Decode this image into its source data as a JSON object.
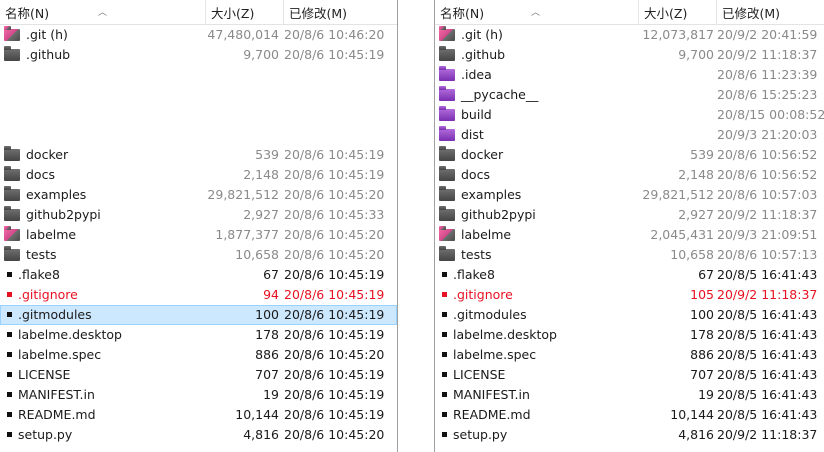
{
  "left": {
    "columns": {
      "name": "名称(N)",
      "size": "大小(Z)",
      "modified": "已修改(M)"
    },
    "rows": [
      {
        "name": ".git (h)",
        "icon": "folder-pink-icon",
        "size": "47,480,014",
        "date": "20/8/6 10:46:20"
      },
      {
        "name": ".github",
        "icon": "folder-gray-icon",
        "size": "9,700",
        "date": "20/8/6 10:45:19"
      },
      {
        "name": "",
        "icon": "",
        "size": "",
        "date": ""
      },
      {
        "name": "",
        "icon": "",
        "size": "",
        "date": ""
      },
      {
        "name": "",
        "icon": "",
        "size": "",
        "date": ""
      },
      {
        "name": "",
        "icon": "",
        "size": "",
        "date": ""
      },
      {
        "name": "docker",
        "icon": "folder-gray-icon",
        "size": "539",
        "date": "20/8/6 10:45:19"
      },
      {
        "name": "docs",
        "icon": "folder-gray-icon",
        "size": "2,148",
        "date": "20/8/6 10:45:19"
      },
      {
        "name": "examples",
        "icon": "folder-gray-icon",
        "size": "29,821,512",
        "date": "20/8/6 10:45:20"
      },
      {
        "name": "github2pypi",
        "icon": "folder-gray-icon",
        "size": "2,927",
        "date": "20/8/6 10:45:33"
      },
      {
        "name": "labelme",
        "icon": "folder-pink-icon",
        "size": "1,877,377",
        "date": "20/8/6 10:45:20"
      },
      {
        "name": "tests",
        "icon": "folder-gray-icon",
        "size": "10,658",
        "date": "20/8/6 10:45:20"
      },
      {
        "name": ".flake8",
        "icon": "file-icon",
        "size": "67",
        "date": "20/8/6 10:45:19"
      },
      {
        "name": ".gitignore",
        "icon": "file-red-icon",
        "size": "94",
        "date": "20/8/6 10:45:19",
        "status": "different"
      },
      {
        "name": ".gitmodules",
        "icon": "file-icon",
        "size": "100",
        "date": "20/8/6 10:45:19",
        "selected": true
      },
      {
        "name": "labelme.desktop",
        "icon": "file-icon",
        "size": "178",
        "date": "20/8/6 10:45:19"
      },
      {
        "name": "labelme.spec",
        "icon": "file-icon",
        "size": "886",
        "date": "20/8/6 10:45:20"
      },
      {
        "name": "LICENSE",
        "icon": "file-icon",
        "size": "707",
        "date": "20/8/6 10:45:19"
      },
      {
        "name": "MANIFEST.in",
        "icon": "file-icon",
        "size": "19",
        "date": "20/8/6 10:45:19"
      },
      {
        "name": "README.md",
        "icon": "file-icon",
        "size": "10,144",
        "date": "20/8/6 10:45:19"
      },
      {
        "name": "setup.py",
        "icon": "file-icon",
        "size": "4,816",
        "date": "20/8/6 10:45:20"
      }
    ]
  },
  "right": {
    "columns": {
      "name": "名称(N)",
      "size": "大小(Z)",
      "modified": "已修改(M)"
    },
    "rows": [
      {
        "name": ".git (h)",
        "icon": "folder-pink-icon",
        "size": "12,073,817",
        "date": "20/9/2 20:41:59"
      },
      {
        "name": ".github",
        "icon": "folder-gray-icon",
        "size": "9,700",
        "date": "20/9/2 11:18:37"
      },
      {
        "name": ".idea",
        "icon": "folder-purple-icon",
        "size": "",
        "date": "20/8/6 11:23:39"
      },
      {
        "name": "__pycache__",
        "icon": "folder-purple-icon",
        "size": "",
        "date": "20/8/6 15:25:23"
      },
      {
        "name": "build",
        "icon": "folder-purple-icon",
        "size": "",
        "date": "20/8/15 00:08:52"
      },
      {
        "name": "dist",
        "icon": "folder-purple-icon",
        "size": "",
        "date": "20/9/3 21:20:03"
      },
      {
        "name": "docker",
        "icon": "folder-gray-icon",
        "size": "539",
        "date": "20/8/6 10:56:52"
      },
      {
        "name": "docs",
        "icon": "folder-gray-icon",
        "size": "2,148",
        "date": "20/8/6 10:56:52"
      },
      {
        "name": "examples",
        "icon": "folder-gray-icon",
        "size": "29,821,512",
        "date": "20/8/6 10:57:03"
      },
      {
        "name": "github2pypi",
        "icon": "folder-gray-icon",
        "size": "2,927",
        "date": "20/9/2 11:18:37"
      },
      {
        "name": "labelme",
        "icon": "folder-pink-icon",
        "size": "2,045,431",
        "date": "20/9/3 21:09:51"
      },
      {
        "name": "tests",
        "icon": "folder-gray-icon",
        "size": "10,658",
        "date": "20/8/6 10:57:13"
      },
      {
        "name": ".flake8",
        "icon": "file-icon",
        "size": "67",
        "date": "20/8/5 16:41:43"
      },
      {
        "name": ".gitignore",
        "icon": "file-red-icon",
        "size": "105",
        "date": "20/9/2 11:18:37",
        "status": "different"
      },
      {
        "name": ".gitmodules",
        "icon": "file-icon",
        "size": "100",
        "date": "20/8/5 16:41:43"
      },
      {
        "name": "labelme.desktop",
        "icon": "file-icon",
        "size": "178",
        "date": "20/8/5 16:41:43"
      },
      {
        "name": "labelme.spec",
        "icon": "file-icon",
        "size": "886",
        "date": "20/8/5 16:41:43"
      },
      {
        "name": "LICENSE",
        "icon": "file-icon",
        "size": "707",
        "date": "20/8/5 16:41:43"
      },
      {
        "name": "MANIFEST.in",
        "icon": "file-icon",
        "size": "19",
        "date": "20/8/5 16:41:43"
      },
      {
        "name": "README.md",
        "icon": "file-icon",
        "size": "10,144",
        "date": "20/8/5 16:41:43"
      },
      {
        "name": "setup.py",
        "icon": "file-icon",
        "size": "4,816",
        "date": "20/9/2 11:18:37"
      }
    ]
  },
  "colors": {
    "selection": "#cce8ff",
    "different": "#e81123",
    "muted": "#8a8a8a"
  }
}
